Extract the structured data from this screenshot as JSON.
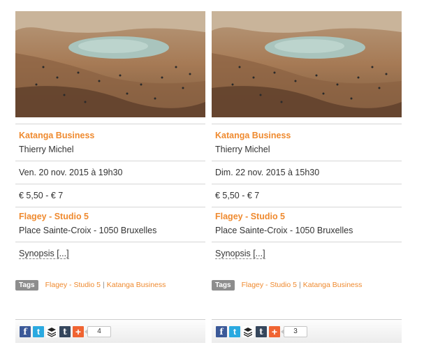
{
  "events": [
    {
      "title": "Katanga Business",
      "director": "Thierry Michel",
      "datetime": "Ven. 20 nov. 2015 à 19h30",
      "price": "€ 5,50 - € 7",
      "venue": "Flagey - Studio 5",
      "address": "Place Sainte-Croix - 1050 Bruxelles",
      "synopsis": "Synopsis [...]",
      "tags_label": "Tags",
      "tags": [
        "Flagey - Studio 5",
        "Katanga Business"
      ],
      "tag_separator": "|",
      "share_count": "4"
    },
    {
      "title": "Katanga Business",
      "director": "Thierry Michel",
      "datetime": "Dim. 22 nov. 2015 à 15h30",
      "price": "€ 5,50 - € 7",
      "venue": "Flagey - Studio 5",
      "address": "Place Sainte-Croix - 1050 Bruxelles",
      "synopsis": "Synopsis [...]",
      "tags_label": "Tags",
      "tags": [
        "Flagey - Studio 5",
        "Katanga Business"
      ],
      "tag_separator": "|",
      "share_count": "3"
    }
  ],
  "share_icons": {
    "facebook": "f",
    "twitter": "t",
    "tumblr": "t",
    "plus": "+"
  },
  "colors": {
    "accent": "#ef8a2f",
    "facebook": "#3b5998",
    "twitter": "#2aa9e0",
    "tumblr": "#35465c",
    "addthis": "#f06432"
  }
}
